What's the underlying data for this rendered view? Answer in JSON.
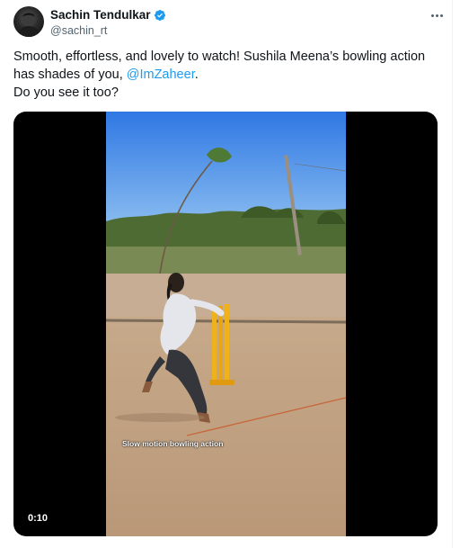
{
  "tweet": {
    "author": {
      "display_name": "Sachin Tendulkar",
      "handle": "@sachin_rt",
      "verified": true
    },
    "text": {
      "line1": "Smooth, effortless, and lovely to watch! Sushila Meena’s bowling action has shades of you, ",
      "mention": "@ImZaheer",
      "line1_end": ".",
      "line2": "Do you see it too?"
    },
    "media": {
      "type": "video",
      "caption": "Slow motion bowling action",
      "duration": "0:10"
    }
  },
  "icons": {
    "verified": "verified-badge-icon",
    "more": "more-options-icon"
  },
  "colors": {
    "accent": "#1d9bf0",
    "text": "#0f1419",
    "secondary": "#536471",
    "media_background": "#000000"
  }
}
